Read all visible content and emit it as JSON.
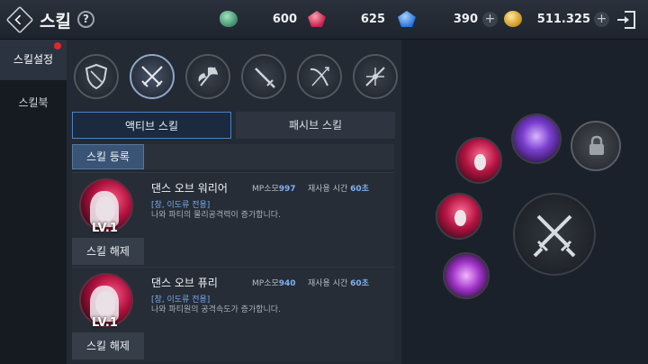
{
  "header": {
    "title": "스킬",
    "help_label": "?",
    "currencies": [
      {
        "icon": "green-gem-icon",
        "value": "600"
      },
      {
        "icon": "red-gem-icon",
        "value": "625"
      },
      {
        "icon": "blue-gem-icon",
        "value": "390"
      },
      {
        "icon": "gold-coin-icon",
        "value": "511.325"
      }
    ],
    "plus_label": "+"
  },
  "sidebar": {
    "items": [
      {
        "label": "스킬설정",
        "active": true,
        "badge": true
      },
      {
        "label": "스킬북",
        "active": false,
        "badge": false
      }
    ]
  },
  "weapons": [
    "shield-icon",
    "dual-swords-icon",
    "axe-icon",
    "sword-icon",
    "bow-icon",
    "staff-icon"
  ],
  "tabs": {
    "active": "액티브 스킬",
    "passive": "패시브 스킬"
  },
  "register_button": "스킬 등록",
  "skills": [
    {
      "name": "댄스 오브 워리어",
      "mp_label": "MP소모",
      "mp_value": "997",
      "cd_label": "재사용 시간",
      "cd_value": "60초",
      "tag": "[창, 이도류 전용]",
      "desc": "나와 파티의 물리공격력이 증가합니다.",
      "level": "LV.1",
      "release_label": "스킬 해제"
    },
    {
      "name": "댄스 오브 퓨리",
      "mp_label": "MP소모",
      "mp_value": "940",
      "cd_label": "재사용 시간",
      "cd_value": "60초",
      "tag": "[창, 이도류 전용]",
      "desc": "나와 파티원의 공격속도가 증가합니다.",
      "level": "LV.1",
      "release_label": "스킬 해제"
    }
  ],
  "colors": {
    "accent": "#4b82c6",
    "badge": "#e0282c",
    "stat_value": "#7fb0ee"
  }
}
